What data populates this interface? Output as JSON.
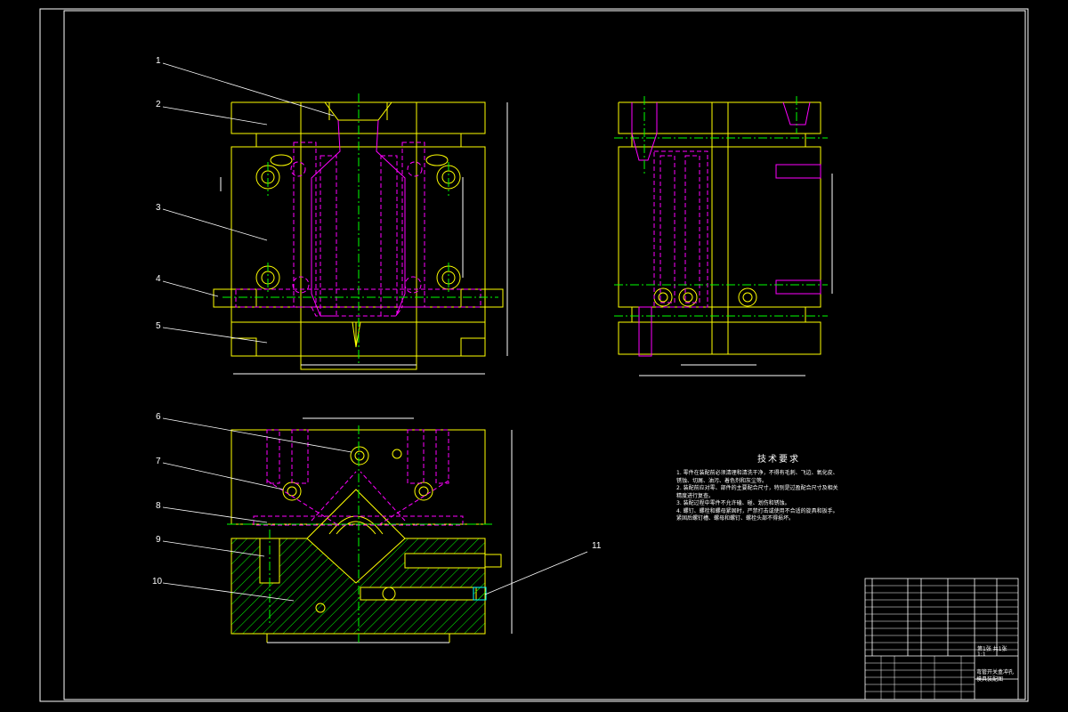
{
  "drawing": {
    "callouts": [
      "1",
      "2",
      "3",
      "4",
      "5",
      "6",
      "7",
      "8",
      "9",
      "10",
      "11"
    ],
    "tech_requirements": {
      "title": "技术要求",
      "lines": [
        "1. 零件在装配前必须清理和清洗干净，不得有毛刺、飞边、氧化皮、",
        "锈蚀、切屑、油污、着色剂和灰尘等。",
        "2. 装配前应对零、部件的主要配合尺寸，特别是过盈配合尺寸及相关",
        "精度进行复查。",
        "3. 装配过程中零件不允许磕、碰、划伤和锈蚀。",
        "4. 螺钉、螺栓和螺母紧固时，严禁打击或使用不合适的旋具和扳手。",
        "紧固后螺钉槽、螺母和螺钉、螺栓头部不得损坏。"
      ]
    },
    "title_block": {
      "drawing_name": "弯管开关盒冲孔模具装配图",
      "scale": "1:1",
      "sheet": "第1张 共1张"
    }
  }
}
